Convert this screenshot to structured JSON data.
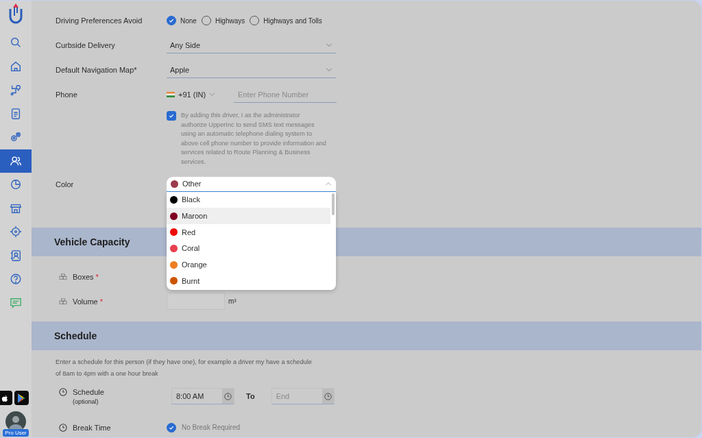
{
  "sidebar": {
    "items": [
      {
        "kind": "search",
        "selected": false
      },
      {
        "kind": "home",
        "selected": false
      },
      {
        "kind": "route",
        "selected": false
      },
      {
        "kind": "list",
        "selected": false
      },
      {
        "kind": "gears",
        "selected": false
      },
      {
        "kind": "people",
        "selected": true
      },
      {
        "kind": "pie",
        "selected": false
      },
      {
        "kind": "store",
        "selected": false
      },
      {
        "kind": "target",
        "selected": false
      },
      {
        "kind": "contact",
        "selected": false
      },
      {
        "kind": "help",
        "selected": false
      },
      {
        "kind": "chat",
        "selected": false
      }
    ],
    "store_links": [
      {
        "kind": "apple"
      },
      {
        "kind": "play"
      }
    ],
    "user": {
      "badge": "Pro User"
    }
  },
  "driving_preferences": {
    "label": "Driving Preferences Avoid",
    "options": [
      {
        "label": "None",
        "selected": true
      },
      {
        "label": "Highways",
        "selected": false
      },
      {
        "label": "Highways and Tolls",
        "selected": false
      }
    ]
  },
  "curbside": {
    "label": "Curbside Delivery",
    "value": "Any Side"
  },
  "navigation_map": {
    "label": "Default Navigation Map*",
    "value": "Apple"
  },
  "phone": {
    "label": "Phone",
    "country": "+91 (IN)",
    "placeholder": "Enter Phone Number",
    "consent": {
      "checked": true,
      "text": "By adding this driver, I as the administrator authorize UpperInc to send SMS text messages using an automatic telephone dialing system to above cell phone number to provide information and services related to Route Planning & Business services."
    }
  },
  "color": {
    "label": "Color",
    "current": {
      "label": "Other",
      "color": "#9b3b4d"
    },
    "expanded": true,
    "options": [
      {
        "label": "Black",
        "color": "#000000",
        "selected": false
      },
      {
        "label": "Maroon",
        "color": "#800020",
        "selected": true
      },
      {
        "label": "Red",
        "color": "#ee0a0a",
        "selected": false
      },
      {
        "label": "Coral",
        "color": "#e8404f",
        "selected": false
      },
      {
        "label": "Orange",
        "color": "#ee7d22",
        "selected": false
      },
      {
        "label": "Burnt",
        "color": "#cc5500",
        "selected": false
      }
    ]
  },
  "vehicle_capacity": {
    "title": "Vehicle Capacity",
    "fields": [
      {
        "label": "Boxes",
        "required_mark": "*"
      },
      {
        "label": "Volume",
        "required_mark": "*",
        "unit": "m³"
      }
    ]
  },
  "schedule": {
    "title": "Schedule",
    "description": "Enter a schedule for this person (if they have one), for example a driver my have a schedule of 8am to 4pm with a one hour break",
    "row": {
      "label": "Schedule",
      "sublabel": "(optional)",
      "start": "8:00 AM",
      "to": "To",
      "end_placeholder": "End"
    },
    "break": {
      "label": "Break Time",
      "option": "No Break Required",
      "checked": true
    }
  }
}
